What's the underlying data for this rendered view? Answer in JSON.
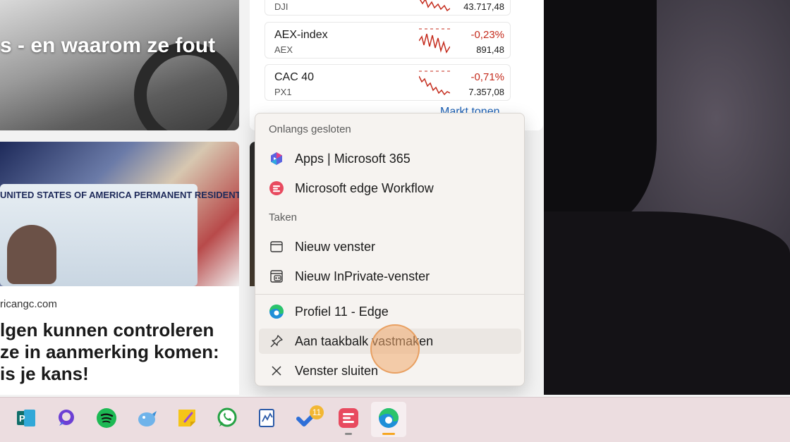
{
  "feed": {
    "top_left_headline": "s - en waarom ze fout",
    "bottom_left_card": {
      "image_caption": "UNITED STATES OF AMERICA PERMANENT RESIDENT",
      "source": "ricangc.com",
      "title_lines": [
        "lgen kunnen controleren",
        "ze in aanmerking komen:",
        " is je kans!"
      ]
    },
    "stocks": [
      {
        "name": "",
        "symbol": "DJI",
        "change": "",
        "value": "43.717,48",
        "change_color": "#c42b1c"
      },
      {
        "name": "AEX-index",
        "symbol": "AEX",
        "change": "-0,23%",
        "value": "891,48",
        "change_color": "#c42b1c"
      },
      {
        "name": "CAC 40",
        "symbol": "PX1",
        "change": "-0,71%",
        "value": "7.357,08",
        "change_color": "#c42b1c"
      }
    ],
    "market_link": "Markt tonen"
  },
  "jumplist": {
    "recent_header": "Onlangs gesloten",
    "recent_items": [
      {
        "label": "Apps | Microsoft 365",
        "icon": "microsoft-365-icon"
      },
      {
        "label": "Microsoft edge Workflow",
        "icon": "workflow-icon"
      }
    ],
    "tasks_header": "Taken",
    "task_items": [
      {
        "label": "Nieuw venster",
        "icon": "window-icon"
      },
      {
        "label": "Nieuw InPrivate-venster",
        "icon": "inprivate-icon"
      }
    ],
    "app_items": [
      {
        "label": "Profiel 11 - Edge",
        "icon": "edge-icon"
      },
      {
        "label": "Aan taakbalk vastmaken",
        "icon": "pin-icon"
      },
      {
        "label": "Venster sluiten",
        "icon": "close-icon"
      }
    ]
  },
  "taskbar": {
    "apps": [
      {
        "name": "Microsoft Planner",
        "icon": "planner-icon"
      },
      {
        "name": "Copilot",
        "icon": "copilot-icon"
      },
      {
        "name": "Spotify",
        "icon": "spotify-icon"
      },
      {
        "name": "Bird app",
        "icon": "bird-icon"
      },
      {
        "name": "Sticky Notes",
        "icon": "sticky-notes-icon"
      },
      {
        "name": "WhatsApp",
        "icon": "whatsapp-icon"
      },
      {
        "name": "Whiteboard",
        "icon": "whiteboard-icon"
      },
      {
        "name": "To Do",
        "icon": "todo-icon",
        "badge": "11"
      },
      {
        "name": "Workflow",
        "icon": "workflow-icon"
      },
      {
        "name": "Microsoft Edge",
        "icon": "edge-icon"
      }
    ]
  }
}
